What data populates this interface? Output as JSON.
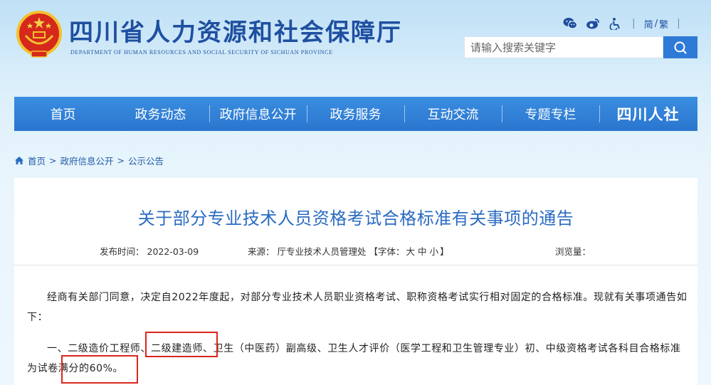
{
  "header": {
    "title": "四川省人力资源和社会保障厅",
    "subtitle": "DEPARTMENT OF HUMAN RESOURCES AND SOCIAL SECURITY OF SICHUAN PROVINCE",
    "tools": {
      "icons": [
        "wechat-icon",
        "weibo-icon",
        "accessibility-icon"
      ],
      "lang_simplified": "简",
      "lang_sep": "/",
      "lang_traditional": "繁"
    },
    "search": {
      "placeholder": "请输入搜索关键字"
    }
  },
  "nav": {
    "items": [
      "首页",
      "政务动态",
      "政府信息公开",
      "政务服务",
      "互动交流",
      "专题专栏"
    ],
    "logo_text": "四川人社"
  },
  "breadcrumb": [
    "首页",
    "政府信息公开",
    "公示公告"
  ],
  "article": {
    "title": "关于部分专业技术人员资格考试合格标准有关事项的通告",
    "publish_label": "发布时间：",
    "publish_date": "2022-03-09",
    "source_label": "来源：",
    "source": "厅专业技术人员管理处",
    "font_label": "【字体：",
    "font_sizes": [
      "大",
      "中",
      "小"
    ],
    "font_close": "】",
    "views_label": "浏览量：",
    "paragraphs": [
      "经商有关部门同意，决定自2022年度起，对部分专业技术人员职业资格考试、职称资格考试实行相对固定的合格标准。现就有关事项通告如下：",
      "一、二级造价工程师、二级建造师、卫生（中医药）副高级、卫生人才评价（医学工程和卫生管理专业）初、中级资格考试各科目合格标准为试卷满分的60%。"
    ]
  },
  "colors": {
    "brand": "#1f4fa0",
    "nav": "#2f7ad6",
    "title": "#2a6bc2",
    "highlight": "#d9261c"
  }
}
